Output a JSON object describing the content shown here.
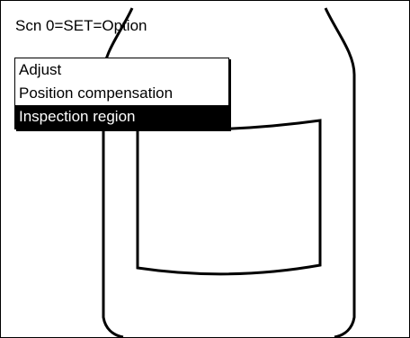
{
  "status": {
    "text": "Scn 0=SET=Option"
  },
  "menu": {
    "items": [
      {
        "label": "Adjust",
        "selected": false
      },
      {
        "label": "Position compensation",
        "selected": false
      },
      {
        "label": "Inspection region",
        "selected": true
      }
    ]
  },
  "colors": {
    "background": "#ffffff",
    "foreground": "#000000",
    "selection_background": "#000000",
    "selection_text": "#ffffff"
  }
}
